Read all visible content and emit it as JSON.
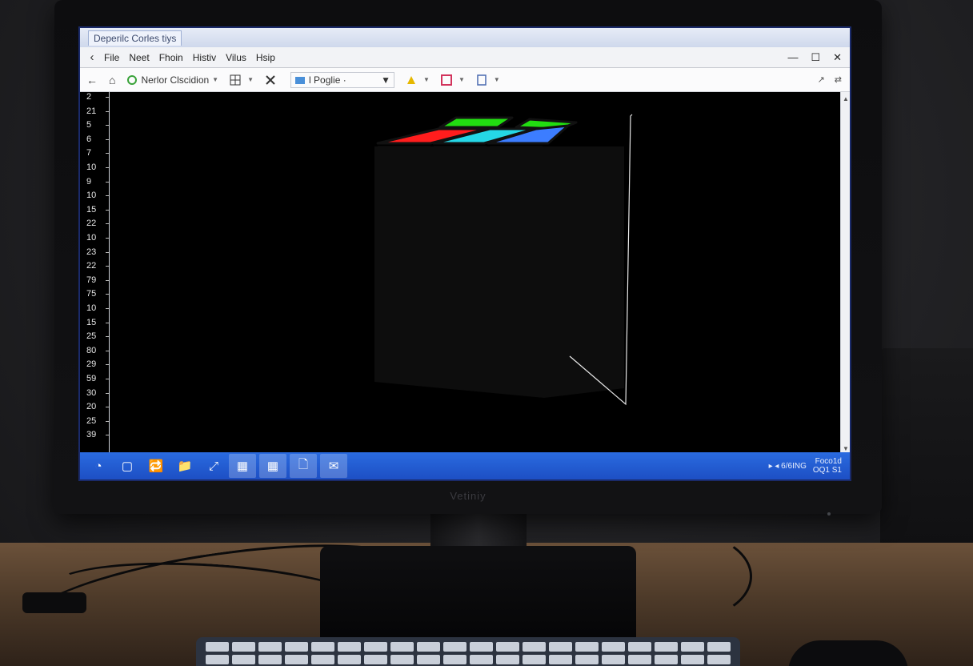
{
  "window": {
    "title": "Deperilc Corles tiys",
    "controls": {
      "minimize": "—",
      "maximize": "☐",
      "close": "✕"
    }
  },
  "menubar": {
    "back_glyph": "‹",
    "items": [
      "File",
      "Neet",
      "Fhoin",
      "Histiv",
      "Vilus",
      "Hsip"
    ]
  },
  "toolbar": {
    "back_glyph": "←",
    "home_glyph": "⌂",
    "location_label": "Nerlor Clscidion",
    "page_field": "l Poglie ·",
    "right_glyphs": [
      "↗",
      "⇄"
    ]
  },
  "ruler": {
    "ticks": [
      "2",
      "21",
      "5",
      "6",
      "7",
      "10",
      "9",
      "10",
      "15",
      "22",
      "10",
      "23",
      "22",
      "79",
      "75",
      "10",
      "15",
      "25",
      "80",
      "29",
      "59",
      "30",
      "20",
      "25",
      "39"
    ]
  },
  "cube": {
    "front_colors": [
      [
        "#ff8a00",
        "#ff1d1d",
        "#22dd11"
      ],
      [
        "#ffe411",
        "#ffe411",
        "#ffe411"
      ],
      [
        "#ffe411",
        "#ffe411",
        "#22dd11"
      ],
      [
        "#ff8a00",
        "#ff1d1d",
        "#ffe411"
      ]
    ],
    "top_colors": [
      "#ff1d1d",
      "#25d7e6",
      "#22dd11",
      "#3c7dff",
      "#22dd11"
    ],
    "side_colors": [
      "#ff1d1d",
      "#ff1d1d",
      "#22dd11",
      "#ff8a00",
      "#22dd11",
      "#22dd11",
      "#ff8a00",
      "#ff8a00",
      "#22dd11",
      "#ff8a00",
      "#ff8a00",
      "#ff8a00"
    ]
  },
  "taskbar": {
    "start_glyph": "◔",
    "apps": [
      "▢",
      "🔁",
      "📁",
      "⤢",
      "▦",
      "▦",
      "🗋",
      "✉"
    ],
    "tray_text": "▸ ◂ 6/6ING",
    "clock_line1": "Foco1d",
    "clock_line2": "OQ1 S1"
  },
  "monitor": {
    "brand": "Vetiniy"
  }
}
